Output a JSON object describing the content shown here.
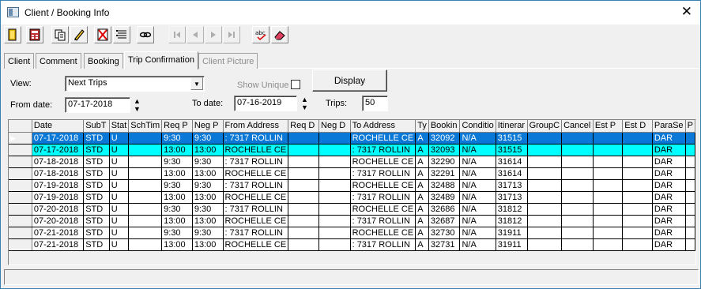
{
  "window": {
    "title": "Client / Booking Info",
    "close_label": "✕"
  },
  "toolbar": {
    "buttons": [
      {
        "name": "exit-door-icon"
      },
      {
        "name": "calculator-icon"
      },
      {
        "name": "copy-icon"
      },
      {
        "name": "edit-pencil-icon"
      },
      {
        "name": "delete-icon"
      },
      {
        "name": "list-icon"
      },
      {
        "name": "link-icon"
      },
      {
        "name": "first-record-icon"
      },
      {
        "name": "previous-record-icon"
      },
      {
        "name": "next-record-icon"
      },
      {
        "name": "last-record-icon"
      },
      {
        "name": "spell-check-icon"
      },
      {
        "name": "eraser-icon"
      }
    ]
  },
  "tabs": [
    {
      "label": "Client",
      "state": "normal"
    },
    {
      "label": "Comment",
      "state": "normal"
    },
    {
      "label": "Booking",
      "state": "normal"
    },
    {
      "label": "Trip Confirmation",
      "state": "active"
    },
    {
      "label": "Client Picture",
      "state": "disabled"
    }
  ],
  "filters": {
    "view_label": "View:",
    "view_value": "Next Trips",
    "from_label": "From date:",
    "from_value": "07-17-2018",
    "to_label": "To date:",
    "to_value": "07-16-2019",
    "show_unique_label": "Show Unique",
    "show_unique_checked": false,
    "display_label": "Display",
    "trips_label": "Trips:",
    "trips_value": "50"
  },
  "grid": {
    "columns": [
      "Date",
      "SubT",
      "Stat",
      "SchTim",
      "Req P",
      "Neg P",
      "From Address",
      "Req D",
      "Neg D",
      "To Address",
      "Ty",
      "Bookin",
      "Conditio",
      "Itinerar",
      "GroupC",
      "Cancel",
      "Est P",
      "Est D",
      "ParaSe",
      "P"
    ],
    "rows": [
      {
        "state": "selected",
        "cells": [
          "07-17-2018",
          "STD",
          "U",
          "",
          "9:30",
          "9:30",
          ": 7317 ROLLIN",
          "",
          "",
          "ROCHELLE CE",
          "A",
          "32092",
          "N/A",
          "31515",
          "",
          "",
          "",
          "",
          "DAR",
          ""
        ]
      },
      {
        "state": "highlight",
        "cells": [
          "07-17-2018",
          "STD",
          "U",
          "",
          "13:00",
          "13:00",
          "ROCHELLE CE",
          "",
          "",
          ": 7317 ROLLIN",
          "A",
          "32093",
          "N/A",
          "31515",
          "",
          "",
          "",
          "",
          "DAR",
          ""
        ]
      },
      {
        "state": "normal",
        "cells": [
          "07-18-2018",
          "STD",
          "U",
          "",
          "9:30",
          "9:30",
          ": 7317 ROLLIN",
          "",
          "",
          "ROCHELLE CE",
          "A",
          "32290",
          "N/A",
          "31614",
          "",
          "",
          "",
          "",
          "DAR",
          ""
        ]
      },
      {
        "state": "normal",
        "cells": [
          "07-18-2018",
          "STD",
          "U",
          "",
          "13:00",
          "13:00",
          "ROCHELLE CE",
          "",
          "",
          ": 7317 ROLLIN",
          "A",
          "32291",
          "N/A",
          "31614",
          "",
          "",
          "",
          "",
          "DAR",
          ""
        ]
      },
      {
        "state": "normal",
        "cells": [
          "07-19-2018",
          "STD",
          "U",
          "",
          "9:30",
          "9:30",
          ": 7317 ROLLIN",
          "",
          "",
          "ROCHELLE CE",
          "A",
          "32488",
          "N/A",
          "31713",
          "",
          "",
          "",
          "",
          "DAR",
          ""
        ]
      },
      {
        "state": "normal",
        "cells": [
          "07-19-2018",
          "STD",
          "U",
          "",
          "13:00",
          "13:00",
          "ROCHELLE CE",
          "",
          "",
          ": 7317 ROLLIN",
          "A",
          "32489",
          "N/A",
          "31713",
          "",
          "",
          "",
          "",
          "DAR",
          ""
        ]
      },
      {
        "state": "normal",
        "cells": [
          "07-20-2018",
          "STD",
          "U",
          "",
          "9:30",
          "9:30",
          ": 7317 ROLLIN",
          "",
          "",
          "ROCHELLE CE",
          "A",
          "32686",
          "N/A",
          "31812",
          "",
          "",
          "",
          "",
          "DAR",
          ""
        ]
      },
      {
        "state": "normal",
        "cells": [
          "07-20-2018",
          "STD",
          "U",
          "",
          "13:00",
          "13:00",
          "ROCHELLE CE",
          "",
          "",
          ": 7317 ROLLIN",
          "A",
          "32687",
          "N/A",
          "31812",
          "",
          "",
          "",
          "",
          "DAR",
          ""
        ]
      },
      {
        "state": "normal",
        "cells": [
          "07-21-2018",
          "STD",
          "U",
          "",
          "9:30",
          "9:30",
          ": 7317 ROLLIN",
          "",
          "",
          "ROCHELLE CE",
          "A",
          "32730",
          "N/A",
          "31911",
          "",
          "",
          "",
          "",
          "DAR",
          ""
        ]
      },
      {
        "state": "normal",
        "cells": [
          "07-21-2018",
          "STD",
          "U",
          "",
          "13:00",
          "13:00",
          "ROCHELLE CE",
          "",
          "",
          ": 7317 ROLLIN",
          "A",
          "32731",
          "N/A",
          "31911",
          "",
          "",
          "",
          "",
          "DAR",
          ""
        ]
      }
    ]
  },
  "colors": {
    "selected_row": "#0a78d7",
    "highlight_row": "#00ffff"
  }
}
